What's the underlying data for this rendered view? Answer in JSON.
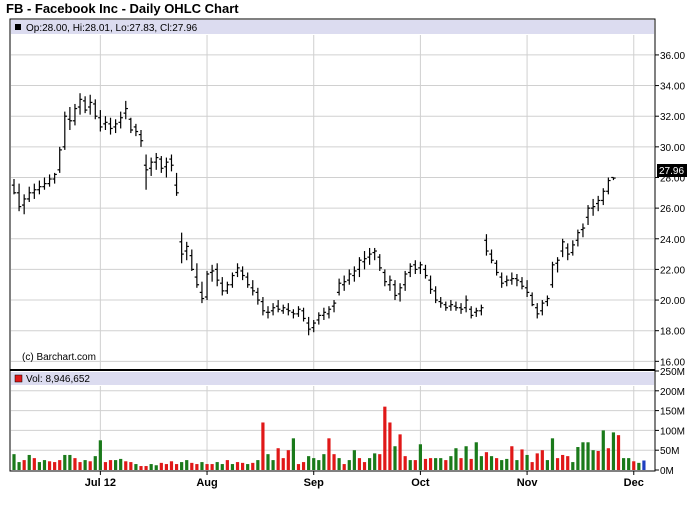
{
  "title": "FB - Facebook Inc - Daily OHLC Chart",
  "price_header": "Op:28.00, Hi:28.01, Lo:27.83, Cl:27.96",
  "volume_header": "Vol: 8,946,652",
  "watermark": "(c) Barchart.com",
  "last_price_label": "27.96",
  "colors": {
    "header_band": "#dcdcf0",
    "grid": "#d0d0d0",
    "up_volume": "#1a7a1a",
    "down_volume": "#e01818",
    "last_volume": "#2040c0",
    "bar": "#000000",
    "last_price_box": "#000000"
  },
  "chart_data": [
    {
      "type": "ohlc",
      "title": "FB - Facebook Inc - Daily OHLC Chart",
      "ylim": [
        15.5,
        37.3
      ],
      "y_ticks": [
        "16.00",
        "18.00",
        "20.00",
        "22.00",
        "24.00",
        "26.00",
        "28.00",
        "30.00",
        "32.00",
        "34.00",
        "36.00"
      ],
      "x_tick_labels": [
        "Jul 12",
        "Aug",
        "Sep",
        "Oct",
        "Nov",
        "Dec"
      ],
      "x_tick_index": [
        17,
        38,
        59,
        80,
        101,
        122
      ],
      "grid": true,
      "last": {
        "open": 28.0,
        "high": 28.01,
        "low": 27.83,
        "close": 27.96
      },
      "bars": [
        [
          27.5,
          27.9,
          26.9,
          27.0
        ],
        [
          27.0,
          27.6,
          25.8,
          26.1
        ],
        [
          26.2,
          26.9,
          25.6,
          26.6
        ],
        [
          26.6,
          27.4,
          26.4,
          27.0
        ],
        [
          27.0,
          27.6,
          26.6,
          27.2
        ],
        [
          27.2,
          27.8,
          26.9,
          27.4
        ],
        [
          27.4,
          28.0,
          27.2,
          27.6
        ],
        [
          27.6,
          28.2,
          27.4,
          27.9
        ],
        [
          27.9,
          28.3,
          27.6,
          28.2
        ],
        [
          28.5,
          30.0,
          28.3,
          29.8
        ],
        [
          30.0,
          32.3,
          29.8,
          32.0
        ],
        [
          31.8,
          32.6,
          31.1,
          31.7
        ],
        [
          31.7,
          32.8,
          31.4,
          32.5
        ],
        [
          32.6,
          33.5,
          32.1,
          33.1
        ],
        [
          33.0,
          33.3,
          32.2,
          32.4
        ],
        [
          32.6,
          33.4,
          32.1,
          32.9
        ],
        [
          32.8,
          33.1,
          31.8,
          32.0
        ],
        [
          31.9,
          32.4,
          31.0,
          31.3
        ],
        [
          31.5,
          32.0,
          31.1,
          31.6
        ],
        [
          31.5,
          31.9,
          30.8,
          31.2
        ],
        [
          31.3,
          31.8,
          30.9,
          31.5
        ],
        [
          31.6,
          32.3,
          31.2,
          31.9
        ],
        [
          32.2,
          33.0,
          31.8,
          32.5
        ],
        [
          31.8,
          31.9,
          30.9,
          31.1
        ],
        [
          31.3,
          31.5,
          30.7,
          31.0
        ],
        [
          30.8,
          31.1,
          30.0,
          30.4
        ],
        [
          28.8,
          29.5,
          27.2,
          28.5
        ],
        [
          28.6,
          29.3,
          28.1,
          29.0
        ],
        [
          29.0,
          29.6,
          28.5,
          29.3
        ],
        [
          29.2,
          29.4,
          28.3,
          28.6
        ],
        [
          28.7,
          29.3,
          28.0,
          29.0
        ],
        [
          29.2,
          29.5,
          28.4,
          28.8
        ],
        [
          27.5,
          28.3,
          26.8,
          27.0
        ],
        [
          23.8,
          24.4,
          22.4,
          23.0
        ],
        [
          23.2,
          23.8,
          22.6,
          23.5
        ],
        [
          22.9,
          23.3,
          21.9,
          22.0
        ],
        [
          21.5,
          22.4,
          20.8,
          21.0
        ],
        [
          20.5,
          21.2,
          19.8,
          20.1
        ],
        [
          20.2,
          21.9,
          20.0,
          21.7
        ],
        [
          21.8,
          22.3,
          21.2,
          21.9
        ],
        [
          22.0,
          22.4,
          20.9,
          21.3
        ],
        [
          21.1,
          21.5,
          20.3,
          20.6
        ],
        [
          20.6,
          21.2,
          20.4,
          21.0
        ],
        [
          21.0,
          21.8,
          20.8,
          21.6
        ],
        [
          21.8,
          22.4,
          21.5,
          22.1
        ],
        [
          21.9,
          22.2,
          21.3,
          21.6
        ],
        [
          21.5,
          21.8,
          20.8,
          21.0
        ],
        [
          20.8,
          21.3,
          20.3,
          20.6
        ],
        [
          20.5,
          20.8,
          19.7,
          20.0
        ],
        [
          19.9,
          20.2,
          19.0,
          19.3
        ],
        [
          19.2,
          19.6,
          18.8,
          19.2
        ],
        [
          19.3,
          19.8,
          19.0,
          19.5
        ],
        [
          19.6,
          20.0,
          19.2,
          19.4
        ],
        [
          19.3,
          19.7,
          19.1,
          19.5
        ],
        [
          19.4,
          19.8,
          19.0,
          19.3
        ],
        [
          19.2,
          19.4,
          18.8,
          19.1
        ],
        [
          19.1,
          19.6,
          18.9,
          19.4
        ],
        [
          19.3,
          19.5,
          18.6,
          18.8
        ],
        [
          18.5,
          18.9,
          17.7,
          18.1
        ],
        [
          18.2,
          18.7,
          17.9,
          18.5
        ],
        [
          18.7,
          19.2,
          18.4,
          19.0
        ],
        [
          19.0,
          19.5,
          18.7,
          19.2
        ],
        [
          19.1,
          19.6,
          18.8,
          19.4
        ],
        [
          19.6,
          20.0,
          19.2,
          19.8
        ],
        [
          20.5,
          21.4,
          20.3,
          21.1
        ],
        [
          21.0,
          21.6,
          20.6,
          21.2
        ],
        [
          21.3,
          22.0,
          21.0,
          21.7
        ],
        [
          21.6,
          22.2,
          21.2,
          21.9
        ],
        [
          22.0,
          22.8,
          21.5,
          22.6
        ],
        [
          22.5,
          23.2,
          22.0,
          22.7
        ],
        [
          22.8,
          23.4,
          22.3,
          23.0
        ],
        [
          23.1,
          23.4,
          22.6,
          23.2
        ],
        [
          22.8,
          23.0,
          21.9,
          22.1
        ],
        [
          21.8,
          22.0,
          20.9,
          21.2
        ],
        [
          21.0,
          21.6,
          20.6,
          21.3
        ],
        [
          21.0,
          21.3,
          20.0,
          20.3
        ],
        [
          20.4,
          21.1,
          19.9,
          20.8
        ],
        [
          21.0,
          21.9,
          20.6,
          21.7
        ],
        [
          21.8,
          22.4,
          21.5,
          22.2
        ],
        [
          22.3,
          22.6,
          21.7,
          22.0
        ],
        [
          22.1,
          22.5,
          21.7,
          22.3
        ],
        [
          22.0,
          22.3,
          21.4,
          21.6
        ],
        [
          21.3,
          21.6,
          20.4,
          20.7
        ],
        [
          20.6,
          20.9,
          19.8,
          20.0
        ],
        [
          19.9,
          20.2,
          19.5,
          19.8
        ],
        [
          19.7,
          19.9,
          19.3,
          19.5
        ],
        [
          19.6,
          20.0,
          19.3,
          19.7
        ],
        [
          19.6,
          19.9,
          19.3,
          19.5
        ],
        [
          19.5,
          19.8,
          19.1,
          19.4
        ],
        [
          19.5,
          20.3,
          19.2,
          20.0
        ],
        [
          19.4,
          19.6,
          18.8,
          19.0
        ],
        [
          19.2,
          19.5,
          18.9,
          19.3
        ],
        [
          19.3,
          19.7,
          19.0,
          19.5
        ],
        [
          23.9,
          24.3,
          22.9,
          23.2
        ],
        [
          23.0,
          23.3,
          22.4,
          22.6
        ],
        [
          22.4,
          22.6,
          21.6,
          21.8
        ],
        [
          21.5,
          21.8,
          20.8,
          21.1
        ],
        [
          21.2,
          21.6,
          20.9,
          21.3
        ],
        [
          21.3,
          21.8,
          21.0,
          21.4
        ],
        [
          21.4,
          21.7,
          20.9,
          21.3
        ],
        [
          21.2,
          21.5,
          20.7,
          20.9
        ],
        [
          20.8,
          21.3,
          20.2,
          20.5
        ],
        [
          20.3,
          20.5,
          19.6,
          19.7
        ],
        [
          19.5,
          19.8,
          18.8,
          19.1
        ],
        [
          19.3,
          20.0,
          19.0,
          19.8
        ],
        [
          19.9,
          20.3,
          19.6,
          20.1
        ],
        [
          21.0,
          22.5,
          20.8,
          22.3
        ],
        [
          22.4,
          22.8,
          21.8,
          22.6
        ],
        [
          23.2,
          24.0,
          22.8,
          23.8
        ],
        [
          23.4,
          23.7,
          22.6,
          23.0
        ],
        [
          23.1,
          23.9,
          22.9,
          23.6
        ],
        [
          23.9,
          24.6,
          23.5,
          24.4
        ],
        [
          24.6,
          25.0,
          24.1,
          24.7
        ],
        [
          25.4,
          26.2,
          24.9,
          26.0
        ],
        [
          26.0,
          26.6,
          25.5,
          26.1
        ],
        [
          26.3,
          26.8,
          25.8,
          26.5
        ],
        [
          26.5,
          27.3,
          26.2,
          27.1
        ],
        [
          27.1,
          28.0,
          26.9,
          27.8
        ],
        [
          28.0,
          28.01,
          27.83,
          27.96
        ]
      ]
    },
    {
      "type": "bar",
      "title": "Vol: 8,946,652",
      "ylim": [
        0,
        250
      ],
      "y_ticks": [
        "0M",
        "50M",
        "100M",
        "150M",
        "200M",
        "250M"
      ],
      "unit": "M",
      "values": [
        40,
        20,
        25,
        38,
        30,
        20,
        25,
        22,
        20,
        25,
        38,
        38,
        30,
        20,
        25,
        22,
        35,
        75,
        20,
        25,
        25,
        28,
        22,
        20,
        15,
        10,
        10,
        15,
        12,
        18,
        15,
        22,
        15,
        20,
        25,
        18,
        15,
        20,
        15,
        15,
        20,
        15,
        25,
        15,
        20,
        18,
        15,
        18,
        25,
        120,
        40,
        25,
        55,
        30,
        50,
        80,
        15,
        20,
        35,
        30,
        25,
        40,
        80,
        40,
        30,
        15,
        25,
        50,
        30,
        20,
        30,
        42,
        40,
        160,
        120,
        60,
        90,
        35,
        25,
        25,
        65,
        28,
        30,
        30,
        30,
        25,
        35,
        55,
        30,
        60,
        28,
        70,
        35,
        45,
        35,
        30,
        25,
        28,
        60,
        25,
        52,
        38,
        20,
        42,
        50,
        25,
        80,
        30,
        38,
        35,
        20,
        58,
        70,
        70,
        50,
        48,
        100,
        55,
        95,
        88,
        30,
        30,
        22,
        18,
        24
      ],
      "direction": [
        "u",
        "u",
        "d",
        "u",
        "d",
        "u",
        "u",
        "d",
        "d",
        "d",
        "u",
        "u",
        "d",
        "d",
        "u",
        "d",
        "u",
        "u",
        "d",
        "d",
        "u",
        "u",
        "d",
        "d",
        "u",
        "d",
        "d",
        "u",
        "u",
        "d",
        "d",
        "d",
        "d",
        "u",
        "u",
        "d",
        "d",
        "u",
        "d",
        "d",
        "u",
        "u",
        "d",
        "u",
        "d",
        "d",
        "u",
        "d",
        "u",
        "d",
        "u",
        "u",
        "d",
        "d",
        "d",
        "u",
        "d",
        "d",
        "u",
        "u",
        "u",
        "u",
        "d",
        "d",
        "u",
        "d",
        "u",
        "u",
        "d",
        "d",
        "u",
        "u",
        "d",
        "d",
        "d",
        "u",
        "d",
        "d",
        "u",
        "d",
        "u",
        "d",
        "d",
        "u",
        "u",
        "d",
        "u",
        "u",
        "d",
        "u",
        "d",
        "u",
        "u",
        "d",
        "u",
        "d",
        "u",
        "u",
        "d",
        "u",
        "d",
        "u",
        "d",
        "d",
        "d",
        "u",
        "u",
        "d",
        "d",
        "d",
        "u",
        "u",
        "u",
        "u",
        "u",
        "d",
        "u",
        "d",
        "u",
        "d",
        "u",
        "u",
        "d",
        "u",
        "l"
      ]
    }
  ]
}
